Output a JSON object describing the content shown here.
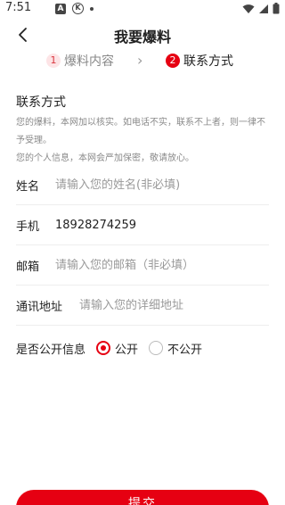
{
  "status_bar": {
    "time": "7:51",
    "icon_a": "A",
    "icon_k": "K"
  },
  "nav": {
    "title": "我要爆料"
  },
  "steps": [
    {
      "num": "1",
      "label": "爆料内容"
    },
    {
      "num": "2",
      "label": "联系方式"
    }
  ],
  "steps_arrow": "›",
  "contact": {
    "section_title": "联系方式",
    "note_1": "您的爆料，本网加以核实。如电话不实，联系不上者，则一律不予受理。",
    "note_2": "您的个人信息，本网会严加保密，敬请放心。"
  },
  "form": {
    "name": {
      "label": "姓名",
      "placeholder": "请输入您的姓名(非必填)",
      "value": ""
    },
    "phone": {
      "label": "手机",
      "placeholder": "",
      "value": "18928274259"
    },
    "email": {
      "label": "邮箱",
      "placeholder": "请输入您的邮箱（非必填）",
      "value": ""
    },
    "address": {
      "label": "通讯地址",
      "placeholder": "请输入您的详细地址",
      "value": ""
    }
  },
  "public_info": {
    "label": "是否公开信息",
    "options": [
      {
        "label": "公开",
        "checked": true
      },
      {
        "label": "不公开",
        "checked": false
      }
    ]
  },
  "submit": {
    "label": "提交"
  },
  "colors": {
    "accent": "#e60012"
  }
}
